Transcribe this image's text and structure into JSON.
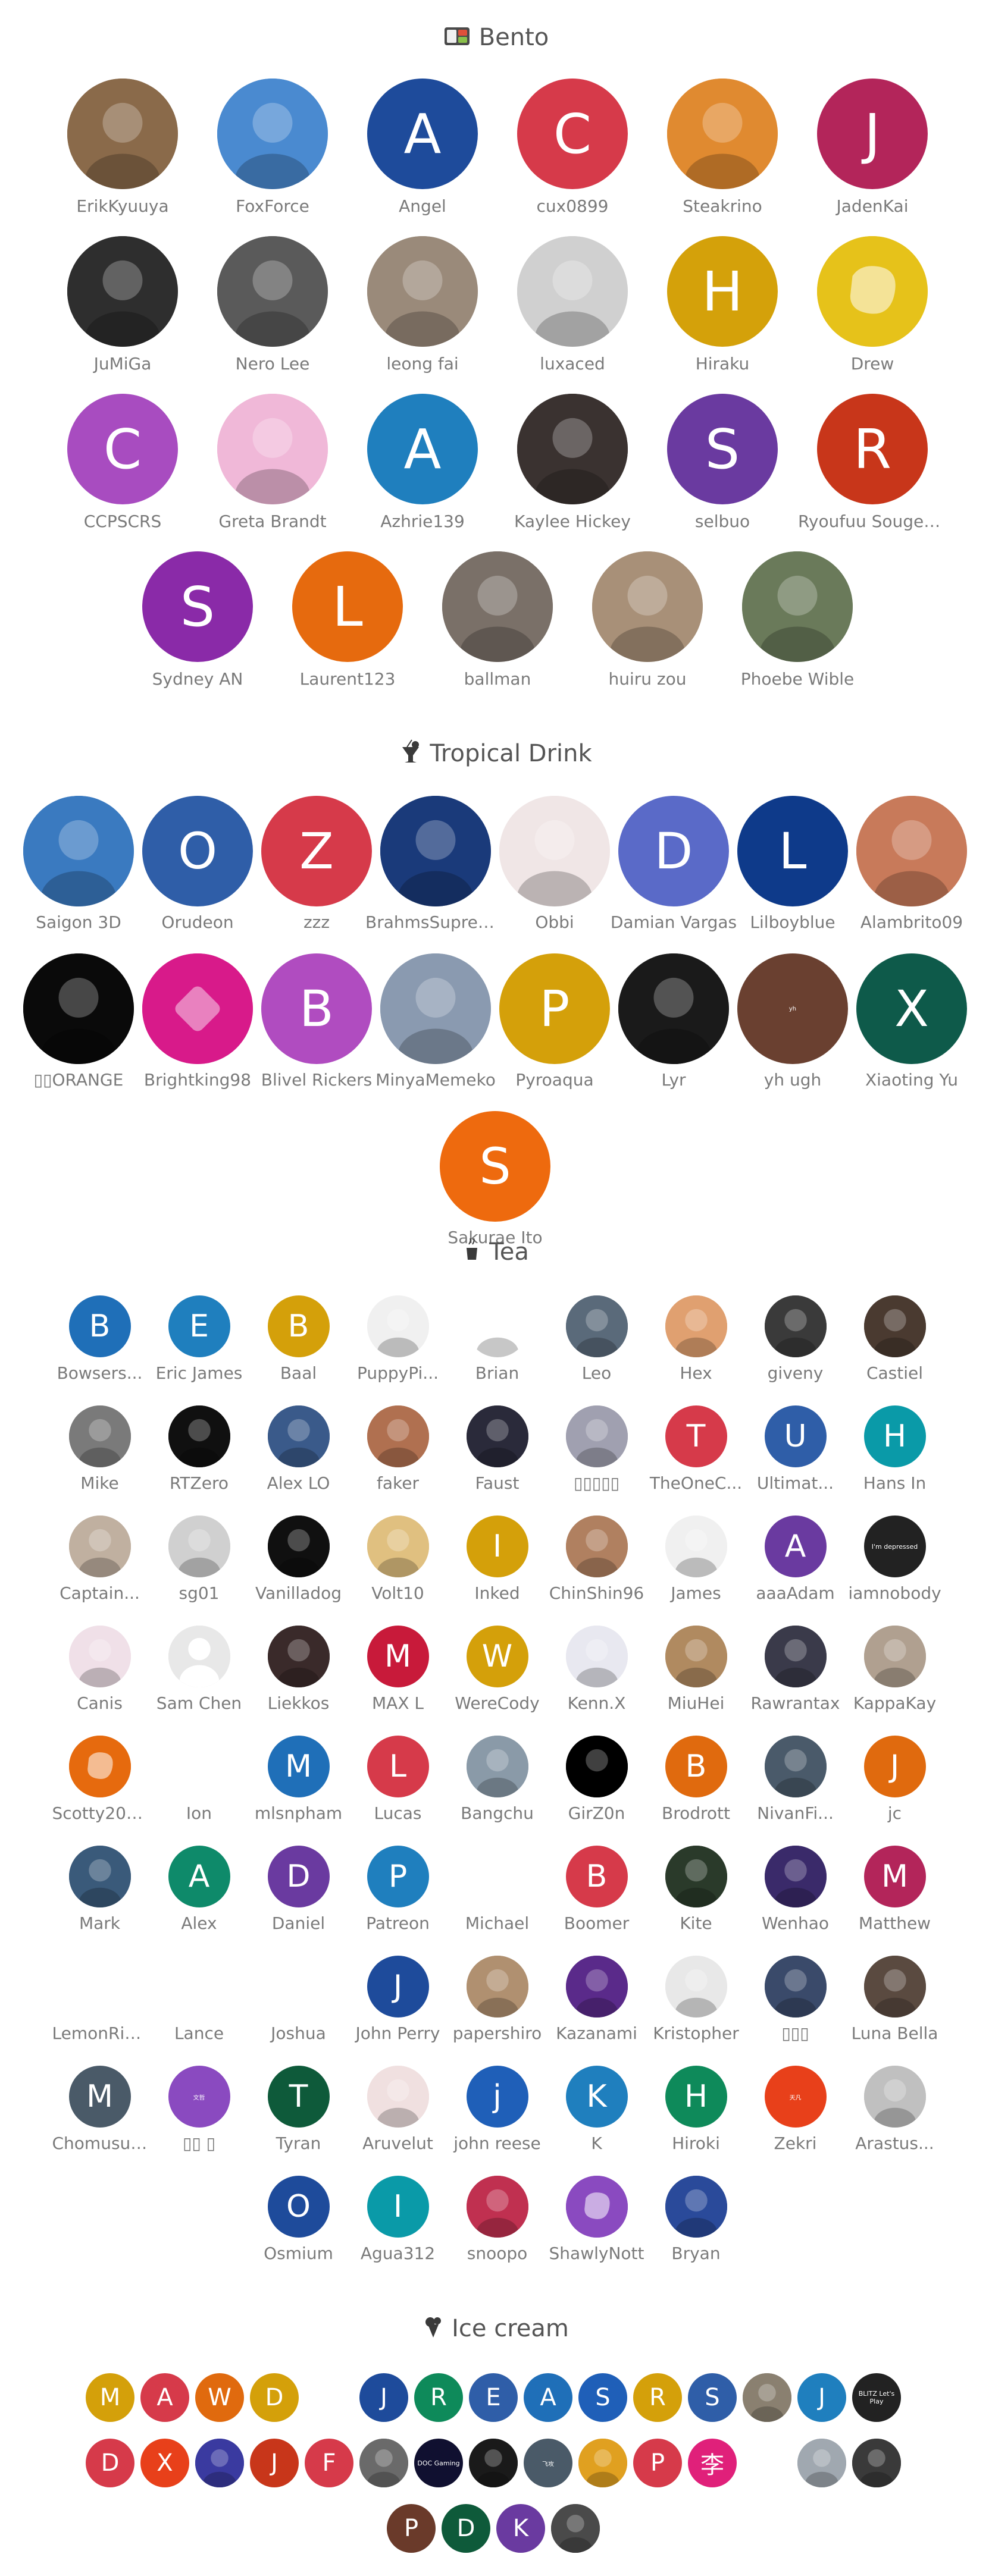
{
  "tiers": {
    "bento": {
      "title": "Bento",
      "icon": "bento-box-icon",
      "supporters": [
        {
          "name": "ErikKyuuya",
          "kind": "photo",
          "bg": "#8a6a4a"
        },
        {
          "name": "FoxForce",
          "kind": "photo",
          "bg": "#4a8ad0"
        },
        {
          "name": "Angel",
          "letter": "A",
          "bg": "#1e4b9b"
        },
        {
          "name": "cux0899",
          "letter": "C",
          "bg": "#d63a4a"
        },
        {
          "name": "Steakrino",
          "kind": "photo",
          "bg": "#e08a30"
        },
        {
          "name": "JadenKai",
          "letter": "J",
          "bg": "#b3255a"
        },
        {
          "name": "JuMiGa",
          "kind": "photo",
          "bg": "#2e2e2e"
        },
        {
          "name": "Nero Lee",
          "kind": "photo",
          "bg": "#5a5a5a"
        },
        {
          "name": "leong fai",
          "kind": "photo",
          "bg": "#9a8a7a"
        },
        {
          "name": "luxaced",
          "kind": "photo",
          "bg": "#d0d0d0"
        },
        {
          "name": "Hiraku",
          "letter": "H",
          "bg": "#d4a10a"
        },
        {
          "name": "Drew",
          "kind": "blob",
          "bg": "#e6c21a"
        },
        {
          "name": "CCPSCRS",
          "letter": "C",
          "bg": "#a84cc0"
        },
        {
          "name": "Greta Brandt",
          "kind": "photo",
          "bg": "#f0b8d8"
        },
        {
          "name": "Azhrie139",
          "letter": "A",
          "bg": "#1f7fbe"
        },
        {
          "name": "Kaylee Hickey",
          "kind": "photo",
          "bg": "#3a3230"
        },
        {
          "name": "selbuo",
          "letter": "S",
          "bg": "#6a3aa0"
        },
        {
          "name": "Ryoufuu Sougetsu",
          "letter": "R",
          "bg": "#c8361a"
        },
        {
          "name": "Sydney AN",
          "letter": "S",
          "bg": "#8a2aa8"
        },
        {
          "name": "Laurent123",
          "letter": "L",
          "bg": "#e66a0e"
        },
        {
          "name": "ballman",
          "kind": "photo",
          "bg": "#7a7068"
        },
        {
          "name": "huiru zou",
          "kind": "photo",
          "bg": "#a89078"
        },
        {
          "name": "Phoebe Wible",
          "kind": "photo",
          "bg": "#6a7a5a"
        }
      ]
    },
    "tropical": {
      "title": "Tropical Drink",
      "icon": "tropical-drink-icon",
      "supporters": [
        {
          "name": "Saigon 3D",
          "kind": "photo",
          "bg": "#3a7ac0"
        },
        {
          "name": "Orudeon",
          "letter": "O",
          "bg": "#2f5ea8"
        },
        {
          "name": "zzz",
          "letter": "Z",
          "bg": "#d63a4a"
        },
        {
          "name": "BrahmsSupremacy",
          "kind": "photo",
          "bg": "#1a3a7a"
        },
        {
          "name": "Obbi",
          "kind": "photo",
          "bg": "#f0e6e6"
        },
        {
          "name": "Damian Vargas",
          "letter": "D",
          "bg": "#5a6ac8"
        },
        {
          "name": "Lilboyblue",
          "letter": "L",
          "bg": "#0e3a8a"
        },
        {
          "name": "Alambrito09",
          "kind": "photo",
          "bg": "#c87a5a"
        },
        {
          "name": "▯▯ORANGE",
          "kind": "photo",
          "bg": "#0a0a0a"
        },
        {
          "name": "Brightking98",
          "kind": "diamond",
          "bg": "#d81a8a"
        },
        {
          "name": "Blivel Rickers",
          "letter": "B",
          "bg": "#b04cc0"
        },
        {
          "name": "MinyaMemeko",
          "kind": "photo",
          "bg": "#8a9ab0"
        },
        {
          "name": "Pyroaqua",
          "letter": "P",
          "bg": "#d4a00a"
        },
        {
          "name": "Lyr",
          "kind": "photo",
          "bg": "#1a1a1a"
        },
        {
          "name": "yh ugh",
          "letter": "yh",
          "bg": "#6a4030"
        },
        {
          "name": "Xiaoting Yu",
          "letter": "X",
          "bg": "#0e5a4a"
        },
        {
          "name": "Sakurae Ito",
          "letter": "S",
          "bg": "#ee6a0e"
        }
      ]
    },
    "tea": {
      "title": "Tea",
      "icon": "tea-icon",
      "supporters": [
        {
          "name": "Bowsers...",
          "letter": "B",
          "bg": "#1f6fb8"
        },
        {
          "name": "Eric James",
          "letter": "E",
          "bg": "#1f7fbe"
        },
        {
          "name": "Baal",
          "letter": "B",
          "bg": "#d4a00a"
        },
        {
          "name": "PuppyPi...",
          "kind": "photo",
          "bg": "#f0f0f0"
        },
        {
          "name": "Brian",
          "kind": "photo",
          "bg": "#ffffff"
        },
        {
          "name": "Leo",
          "kind": "photo",
          "bg": "#5a6a7a"
        },
        {
          "name": "Hex",
          "kind": "photo",
          "bg": "#e0a070"
        },
        {
          "name": "giveny",
          "kind": "photo",
          "bg": "#3a3a3a"
        },
        {
          "name": "Castiel",
          "kind": "photo",
          "bg": "#4a3a30"
        },
        {
          "name": "Mike",
          "kind": "photo",
          "bg": "#7a7a7a"
        },
        {
          "name": "RTZero",
          "kind": "photo",
          "bg": "#101010"
        },
        {
          "name": "Alex LO",
          "kind": "photo",
          "bg": "#3a5a8a"
        },
        {
          "name": "faker",
          "kind": "photo",
          "bg": "#b07050"
        },
        {
          "name": "Faust",
          "kind": "photo",
          "bg": "#2a2a3a"
        },
        {
          "name": "▯▯▯▯▯",
          "kind": "photo",
          "bg": "#a0a0b0"
        },
        {
          "name": "TheOneC...",
          "letter": "T",
          "bg": "#d63a4a"
        },
        {
          "name": "Ultimat...",
          "letter": "U",
          "bg": "#2f5ea8"
        },
        {
          "name": "Hans In",
          "letter": "H",
          "bg": "#0a9aa8"
        },
        {
          "name": "Captain...",
          "kind": "photo",
          "bg": "#c0b0a0"
        },
        {
          "name": "sg01",
          "kind": "photo",
          "bg": "#d0d0d0"
        },
        {
          "name": "Vanilladog",
          "kind": "photo",
          "bg": "#101010"
        },
        {
          "name": "Volt10",
          "kind": "photo",
          "bg": "#e0c080"
        },
        {
          "name": "Inked",
          "letter": "I",
          "bg": "#d4a00a"
        },
        {
          "name": "ChinShin96",
          "kind": "photo",
          "bg": "#b08060"
        },
        {
          "name": "James",
          "kind": "photo",
          "bg": "#f0f0f0"
        },
        {
          "name": "aaaAdam",
          "letter": "A",
          "bg": "#6a3aa0"
        },
        {
          "name": "iamnobody",
          "kind": "text",
          "bg": "#222222",
          "text": "I'm depressed"
        },
        {
          "name": "Canis",
          "kind": "photo",
          "bg": "#f0e0e8"
        },
        {
          "name": "Sam Chen",
          "kind": "silhouette",
          "bg": "#e6e6e6"
        },
        {
          "name": "Liekkos",
          "kind": "photo",
          "bg": "#3a2a2a"
        },
        {
          "name": "MAX L",
          "letter": "M",
          "bg": "#c81a3a"
        },
        {
          "name": "WereCody",
          "letter": "W",
          "bg": "#d4a00a"
        },
        {
          "name": "Kenn.X",
          "kind": "photo",
          "bg": "#e8e8f0"
        },
        {
          "name": "MiuHei",
          "kind": "photo",
          "bg": "#b08a60"
        },
        {
          "name": "Rawrantax",
          "kind": "photo",
          "bg": "#3a3a4a"
        },
        {
          "name": "KappaKay",
          "kind": "photo",
          "bg": "#b0a090"
        },
        {
          "name": "Scotty2024",
          "kind": "blob",
          "bg": "#e66a0e"
        },
        {
          "name": "Ion",
          "kind": "empty",
          "bg": "#ffffff"
        },
        {
          "name": "mlsnpham",
          "letter": "M",
          "bg": "#1f6fb8"
        },
        {
          "name": "Lucas",
          "letter": "L",
          "bg": "#d63a4a"
        },
        {
          "name": "Bangchu",
          "kind": "photo",
          "bg": "#8a9aa8"
        },
        {
          "name": "GirZ0n",
          "kind": "photo",
          "bg": "#000000"
        },
        {
          "name": "Brodrott",
          "letter": "B",
          "bg": "#e06a0e"
        },
        {
          "name": "NivanFi...",
          "kind": "photo",
          "bg": "#4a5a6a"
        },
        {
          "name": "jc",
          "letter": "J",
          "bg": "#e06a0e"
        },
        {
          "name": "Mark",
          "kind": "photo",
          "bg": "#3a5a7a"
        },
        {
          "name": "Alex",
          "letter": "A",
          "bg": "#0e8a6a"
        },
        {
          "name": "Daniel",
          "letter": "D",
          "bg": "#6a3aa0"
        },
        {
          "name": "Patreon",
          "letter": "P",
          "bg": "#1f7fbe"
        },
        {
          "name": "Michael",
          "kind": "empty",
          "bg": "#ffffff"
        },
        {
          "name": "Boomer",
          "letter": "B",
          "bg": "#d63a4a"
        },
        {
          "name": "Kite",
          "kind": "photo",
          "bg": "#2a3a2a"
        },
        {
          "name": "Wenhao",
          "kind": "photo",
          "bg": "#3a2a6a"
        },
        {
          "name": "Matthew",
          "letter": "M",
          "bg": "#b3255a"
        },
        {
          "name": "LemonRider",
          "kind": "empty",
          "bg": "#ffffff"
        },
        {
          "name": "Lance",
          "kind": "empty",
          "bg": "#ffffff"
        },
        {
          "name": "Joshua",
          "kind": "empty",
          "bg": "#ffffff"
        },
        {
          "name": "John Perry",
          "letter": "J",
          "bg": "#1e4b9b"
        },
        {
          "name": "papershiro",
          "kind": "photo",
          "bg": "#b09070"
        },
        {
          "name": "Kazanami",
          "kind": "photo",
          "bg": "#5a2a8a"
        },
        {
          "name": "Kristopher",
          "kind": "photo",
          "bg": "#e8e8e8"
        },
        {
          "name": "▯▯▯",
          "kind": "photo",
          "bg": "#3a4a6a"
        },
        {
          "name": "Luna Bella",
          "kind": "photo",
          "bg": "#5a4a40"
        },
        {
          "name": "Chomusuke",
          "letter": "M",
          "bg": "#4a5a68"
        },
        {
          "name": "▯▯ ▯",
          "letter": "文哲",
          "bg": "#8a4ac0"
        },
        {
          "name": "Tyran",
          "letter": "T",
          "bg": "#0e5a3a"
        },
        {
          "name": "Aruvelut",
          "kind": "photo",
          "bg": "#f0e0e0"
        },
        {
          "name": "john reese",
          "letter": "j",
          "bg": "#1f5fb8"
        },
        {
          "name": "K",
          "letter": "K",
          "bg": "#1f7fbe"
        },
        {
          "name": "Hiroki",
          "letter": "H",
          "bg": "#0e8a5a"
        },
        {
          "name": "Zekri",
          "letter": "天凡",
          "bg": "#e8401a"
        },
        {
          "name": "Arastus...",
          "kind": "photo",
          "bg": "#c0c0c0"
        },
        {
          "name": "Osmium",
          "letter": "O",
          "bg": "#1e4b9b"
        },
        {
          "name": "Agua312",
          "letter": "I",
          "bg": "#0a9aa8"
        },
        {
          "name": "snoopo",
          "kind": "photo",
          "bg": "#c03050"
        },
        {
          "name": "ShawlyNott",
          "kind": "blob",
          "bg": "#8a4ac0"
        },
        {
          "name": "Bryan",
          "kind": "photo",
          "bg": "#2a4a9a"
        }
      ]
    },
    "icecream": {
      "title": "Ice cream",
      "icon": "ice-cream-icon",
      "rows": [
        [
          {
            "letter": "M",
            "bg": "#d4a00a"
          },
          {
            "letter": "A",
            "bg": "#d63a4a"
          },
          {
            "letter": "W",
            "bg": "#e06a0e"
          },
          {
            "letter": "D",
            "bg": "#d4a00a"
          },
          {
            "kind": "empty",
            "bg": "#ffffff"
          },
          {
            "letter": "J",
            "bg": "#1e4b9b"
          },
          {
            "letter": "R",
            "bg": "#0e8a5a"
          },
          {
            "letter": "E",
            "bg": "#2f5ea8"
          },
          {
            "letter": "A",
            "bg": "#1f6fb8"
          },
          {
            "letter": "S",
            "bg": "#1f5fb8"
          },
          {
            "letter": "R",
            "bg": "#d4a00a"
          },
          {
            "letter": "S",
            "bg": "#2f5ea8"
          },
          {
            "kind": "photo",
            "bg": "#8a8070"
          },
          {
            "letter": "J",
            "bg": "#1f7fbe"
          },
          {
            "kind": "text",
            "bg": "#222222",
            "text": "BLITZ Let's Play"
          }
        ],
        [
          {
            "letter": "D",
            "bg": "#d63a4a"
          },
          {
            "letter": "X",
            "bg": "#e8401a"
          },
          {
            "kind": "photo",
            "bg": "#3a3aa0"
          },
          {
            "letter": "J",
            "bg": "#c8361a"
          },
          {
            "letter": "F",
            "bg": "#d63a4a"
          },
          {
            "kind": "photo",
            "bg": "#6a6a6a"
          },
          {
            "kind": "text",
            "bg": "#101030",
            "text": "DOC Gaming"
          },
          {
            "kind": "photo",
            "bg": "#1a1a1a"
          },
          {
            "letter": "飞攻",
            "bg": "#4a5a68"
          },
          {
            "kind": "photo",
            "bg": "#e0a020"
          },
          {
            "letter": "P",
            "bg": "#d63a4a"
          },
          {
            "letter": "李",
            "bg": "#e0207a"
          },
          {
            "kind": "empty",
            "bg": "#ffffff"
          },
          {
            "kind": "photo",
            "bg": "#a0a8b0"
          },
          {
            "kind": "photo",
            "bg": "#3a3a3a"
          }
        ],
        [
          {
            "letter": "P",
            "bg": "#6a3a2a"
          },
          {
            "letter": "D",
            "bg": "#0e5a3a"
          },
          {
            "letter": "K",
            "bg": "#6a3aa0"
          },
          {
            "kind": "photo",
            "bg": "#4a4a4a"
          }
        ]
      ]
    }
  }
}
